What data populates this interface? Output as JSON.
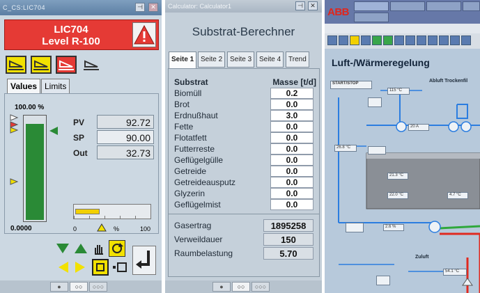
{
  "panel1": {
    "window_title": "C_CS:LIC704",
    "tag": "LIC704",
    "description": "Level R-100",
    "tabs": [
      "Values",
      "Limits"
    ],
    "bar_top_label": "100.00 %",
    "bar_bottom_label": "0.0000",
    "level_fraction": 0.92,
    "pv_label": "PV",
    "pv_value": "92.72",
    "sp_label": "SP",
    "sp_value": "90.00",
    "out_label": "Out",
    "out_value": "32.73",
    "out_fraction": 0.33,
    "out_scale_min": "0",
    "out_scale_unit": "%",
    "out_scale_max": "100",
    "colors": {
      "alarm": "#e53a35",
      "level": "#2a8a36",
      "output": "#f2d000"
    }
  },
  "panel2": {
    "window_title": "Calculator: Calculator1",
    "heading": "Substrat-Berechner",
    "tabs": [
      "Seite 1",
      "Seite 2",
      "Seite 3",
      "Seite 4",
      "Trend"
    ],
    "col_substrat": "Substrat",
    "col_masse": "Masse [t/d]",
    "rows": [
      {
        "name": "Biomüll",
        "value": "0.2"
      },
      {
        "name": "Brot",
        "value": "0.0"
      },
      {
        "name": "Erdnußhaut",
        "value": "3.0"
      },
      {
        "name": "Fette",
        "value": "0.0"
      },
      {
        "name": "Flotatfett",
        "value": "0.0"
      },
      {
        "name": "Futterreste",
        "value": "0.0"
      },
      {
        "name": "Geflügelgülle",
        "value": "0.0"
      },
      {
        "name": "Getreide",
        "value": "0.0"
      },
      {
        "name": "Getreideausputz",
        "value": "0.0"
      },
      {
        "name": "Glyzerin",
        "value": "0.0"
      },
      {
        "name": "Geflügelmist",
        "value": "0.0"
      }
    ],
    "results": [
      {
        "name": "Gasertrag",
        "value": "1895258"
      },
      {
        "name": "Verweildauer",
        "value": "150"
      },
      {
        "name": "Raumbelastung",
        "value": "5.70"
      }
    ]
  },
  "panel3": {
    "logo": "ABB",
    "title": "Luft-/Wärmeregelung",
    "start_stop": "START/STOP",
    "abluft_label": "Abluft Trockenfil",
    "zuluft_label": "Zuluft",
    "readouts": [
      "115  °C",
      "26.8  °C",
      "20  A",
      "21.3  °C",
      "22.0  °C",
      "4.7  °C",
      "2.6  %",
      "54.1  °C"
    ]
  }
}
